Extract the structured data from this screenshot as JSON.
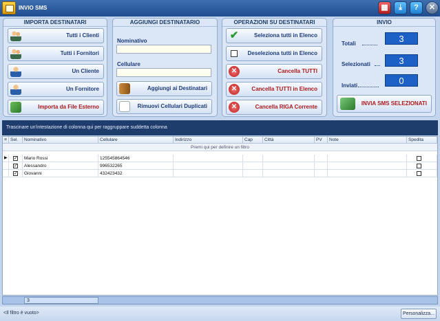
{
  "window": {
    "title": "INVIO SMS",
    "buttons": {
      "calc": "▦",
      "download": "⤓",
      "help": "?",
      "close": "✕"
    }
  },
  "importa": {
    "title": "IMPORTA DESTINATARI",
    "buttons": [
      {
        "label": "Tutti i Clienti",
        "icon": "users-icon"
      },
      {
        "label": "Tutti i Fornitori",
        "icon": "users-icon"
      },
      {
        "label": "Un Cliente",
        "icon": "user-icon"
      },
      {
        "label": "Un Fornitore",
        "icon": "user-icon"
      },
      {
        "label": "Importa da File Esterno",
        "icon": "import-icon"
      }
    ]
  },
  "aggiungi": {
    "title": "AGGIUNGI DESTINATARIO",
    "nominativo_label": "Nominativo",
    "nominativo_value": "",
    "cellulare_label": "Cellulare",
    "cellulare_value": "",
    "add_button": "Aggiungi ai Destinatari",
    "remove_dup_button": "Rimuovi Cellulari Duplicati"
  },
  "operazioni": {
    "title": "OPERAZIONI SU DESTINATARI",
    "select_all": "Seleziona tutti in Elenco",
    "deselect_all": "Deseleziona tutti in Elenco",
    "cancel_all": "Cancella TUTTI",
    "cancel_all_list": "Cancella TUTTI in Elenco",
    "cancel_row": "Cancella RIGA Corrente"
  },
  "invio": {
    "title": "INVIO",
    "totali_label": "Totali",
    "totali_value": "3",
    "selezionati_label": "Selezionati",
    "selezionati_value": "3",
    "inviati_label": "Inviati",
    "inviati_value": "0",
    "send_button": "INVIA SMS SELEZIONATI"
  },
  "grid": {
    "group_hint": "Trascinare un'intestazione di colonna qui per raggruppare suddetta colonna",
    "filter_hint": "Premi qui per definire un filtro",
    "columns": [
      "Sel.",
      "Nominativo",
      "Cellulare",
      "Indirizzo",
      "Cap",
      "Città",
      "PV",
      "Note",
      "Spedita"
    ],
    "rows": [
      {
        "sel": true,
        "nominativo": "Mario Rossi",
        "cellulare": "125545864546",
        "indirizzo": "",
        "cap": "",
        "citta": "",
        "pv": "",
        "note": "",
        "spedita": false
      },
      {
        "sel": true,
        "nominativo": "Alessandro",
        "cellulare": "996532265",
        "indirizzo": "",
        "cap": "",
        "citta": "",
        "pv": "",
        "note": "",
        "spedita": false
      },
      {
        "sel": true,
        "nominativo": "Giovanni",
        "cellulare": "432423432",
        "indirizzo": "",
        "cap": "",
        "citta": "",
        "pv": "",
        "note": "",
        "spedita": false
      }
    ],
    "row_count": "3"
  },
  "status": {
    "filter_text": "<Il filtro è vuoto>",
    "customize_button": "Personalizza..."
  }
}
